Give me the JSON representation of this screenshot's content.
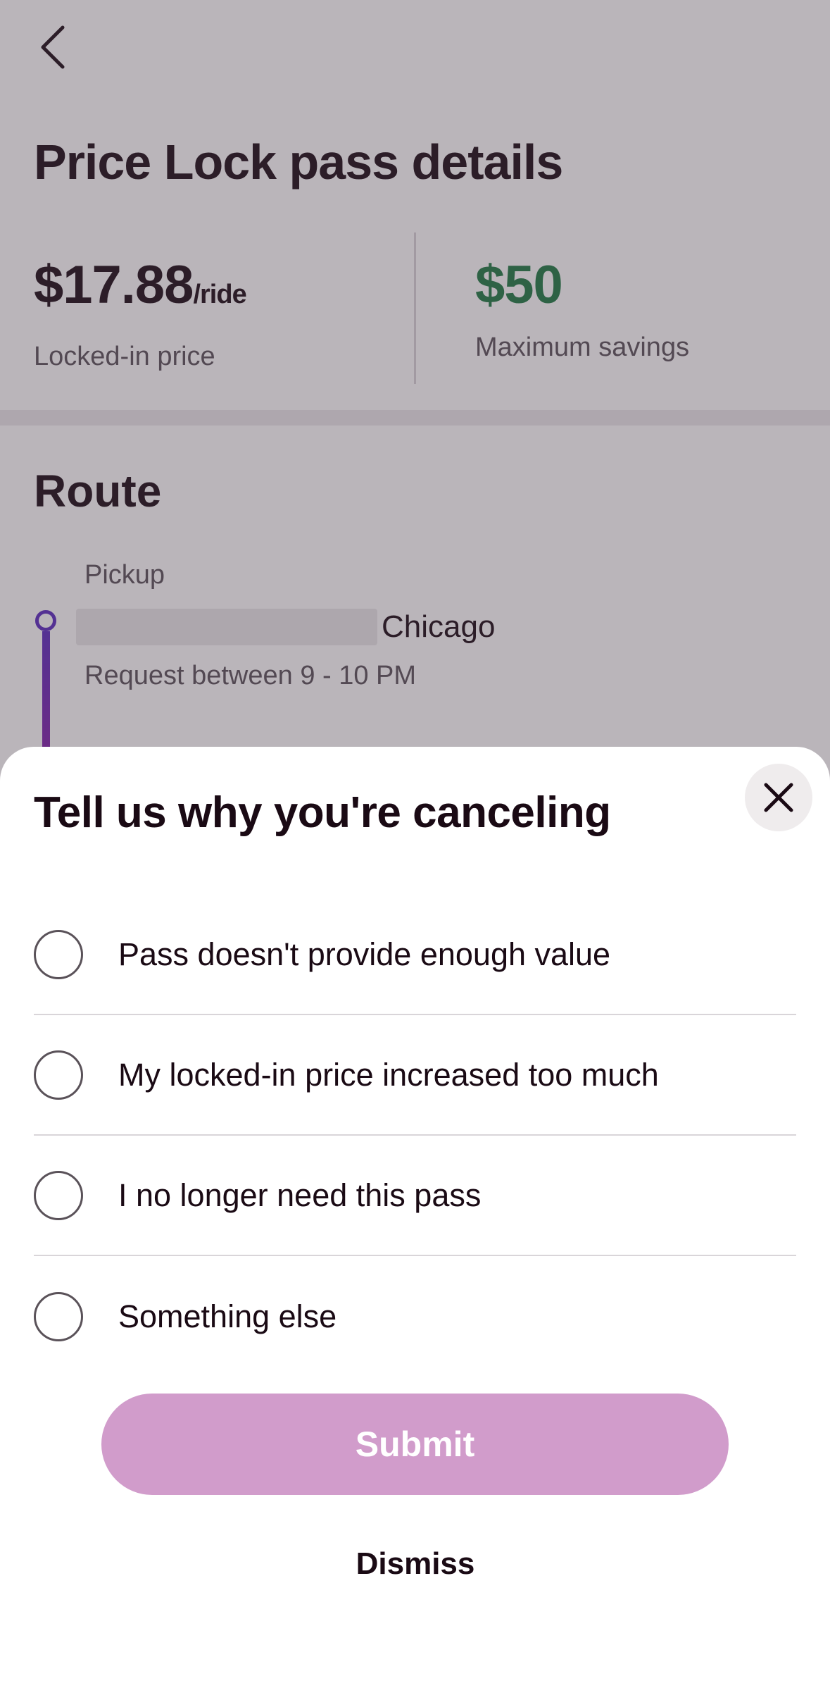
{
  "page": {
    "title": "Price Lock pass details",
    "locked_price": {
      "amount": "$17.88",
      "unit": "/ride",
      "caption": "Locked-in price"
    },
    "max_savings": {
      "amount": "$50",
      "caption": "Maximum savings"
    },
    "route": {
      "title": "Route",
      "pickup_label": "Pickup",
      "pickup_city": "Chicago",
      "pickup_time": "Request between 9 - 10 PM"
    }
  },
  "sheet": {
    "title": "Tell us why you're canceling",
    "options": [
      {
        "label": "Pass doesn't provide enough value"
      },
      {
        "label": "My locked-in price increased too much"
      },
      {
        "label": "I no longer need this pass"
      },
      {
        "label": "Something else"
      }
    ],
    "submit_label": "Submit",
    "dismiss_label": "Dismiss"
  },
  "colors": {
    "accent_disabled": "#d19ccb",
    "savings_green": "#1e7a43",
    "route_purple": "#5b2bc0"
  },
  "icons": {
    "back": "chevron-left-icon",
    "close": "close-icon"
  }
}
